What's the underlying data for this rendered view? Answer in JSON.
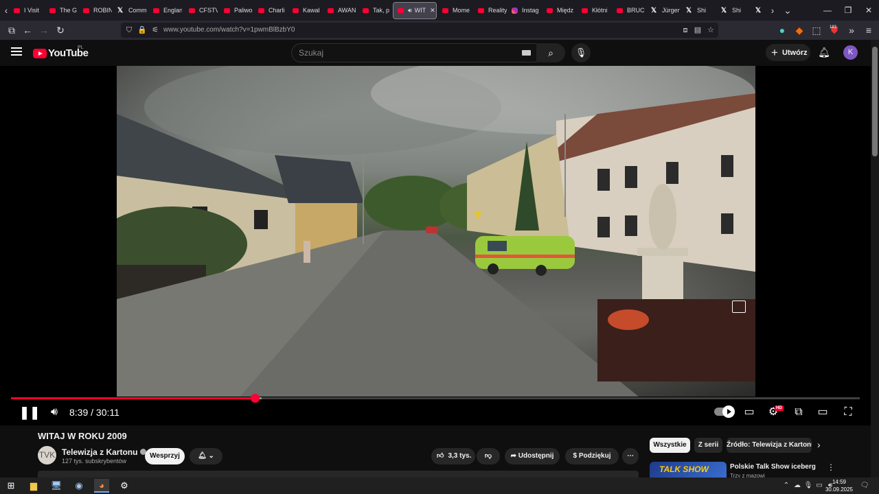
{
  "browser": {
    "tabs": [
      {
        "label": "I Visit",
        "fav": "yt"
      },
      {
        "label": "The G",
        "fav": "yt"
      },
      {
        "label": "ROBIN",
        "fav": "yt"
      },
      {
        "label": "Comm",
        "fav": "x"
      },
      {
        "label": "Englan",
        "fav": "yt"
      },
      {
        "label": "CFSTV",
        "fav": "yt"
      },
      {
        "label": "Paliwo",
        "fav": "yt"
      },
      {
        "label": "Charli",
        "fav": "yt"
      },
      {
        "label": "Kawal",
        "fav": "yt"
      },
      {
        "label": "AWAN",
        "fav": "yt"
      },
      {
        "label": "Tak, p",
        "fav": "yt"
      },
      {
        "label": "WIT",
        "fav": "yt",
        "active": true
      },
      {
        "label": "Mome",
        "fav": "yt"
      },
      {
        "label": "Reality",
        "fav": "yt"
      },
      {
        "label": "Instag",
        "fav": "ig"
      },
      {
        "label": "Międz",
        "fav": "yt"
      },
      {
        "label": "Kłótni",
        "fav": "yt"
      },
      {
        "label": "BRUC",
        "fav": "yt"
      },
      {
        "label": "Jürgen",
        "fav": "x"
      },
      {
        "label": "Shi",
        "fav": "x"
      },
      {
        "label": "Shi",
        "fav": "x"
      },
      {
        "label": "(",
        "fav": "x"
      }
    ],
    "url": "www.youtube.com/watch?v=1pwmBlBzbY0",
    "extension_badge": "183"
  },
  "youtube": {
    "logo_text": "YouTube",
    "country_code": "PL",
    "search_placeholder": "Szukaj",
    "create_label": "Utwórz",
    "avatar_letter": "K"
  },
  "player": {
    "current_time": "8:39",
    "duration": "30:11",
    "time_display": "8:39 / 30:11",
    "played_fraction": 0.287,
    "loaded_fraction": 0.295,
    "hd_badge": "HD"
  },
  "video": {
    "title": "WITAJ W ROKU 2009",
    "channel_name": "Telewizja z Kartonu",
    "channel_initials": "TVK",
    "subscribers": "127 tys. subskrybentów",
    "support_label": "Wesprzyj",
    "likes": "3,3 tys.",
    "share_label": "Udostępnij",
    "thanks_label": "Podziękuj"
  },
  "sidebar": {
    "chips": [
      "Wszystkie",
      "Z serii",
      "Źródło: Telewizja z Kartonu"
    ],
    "recommendation": {
      "thumb_text": "TALK SHOW",
      "title": "Polskie Talk Show iceberg",
      "channel": "Trzy z mazowi"
    }
  },
  "taskbar": {
    "time": "14:59",
    "date": "30.09.2025"
  }
}
